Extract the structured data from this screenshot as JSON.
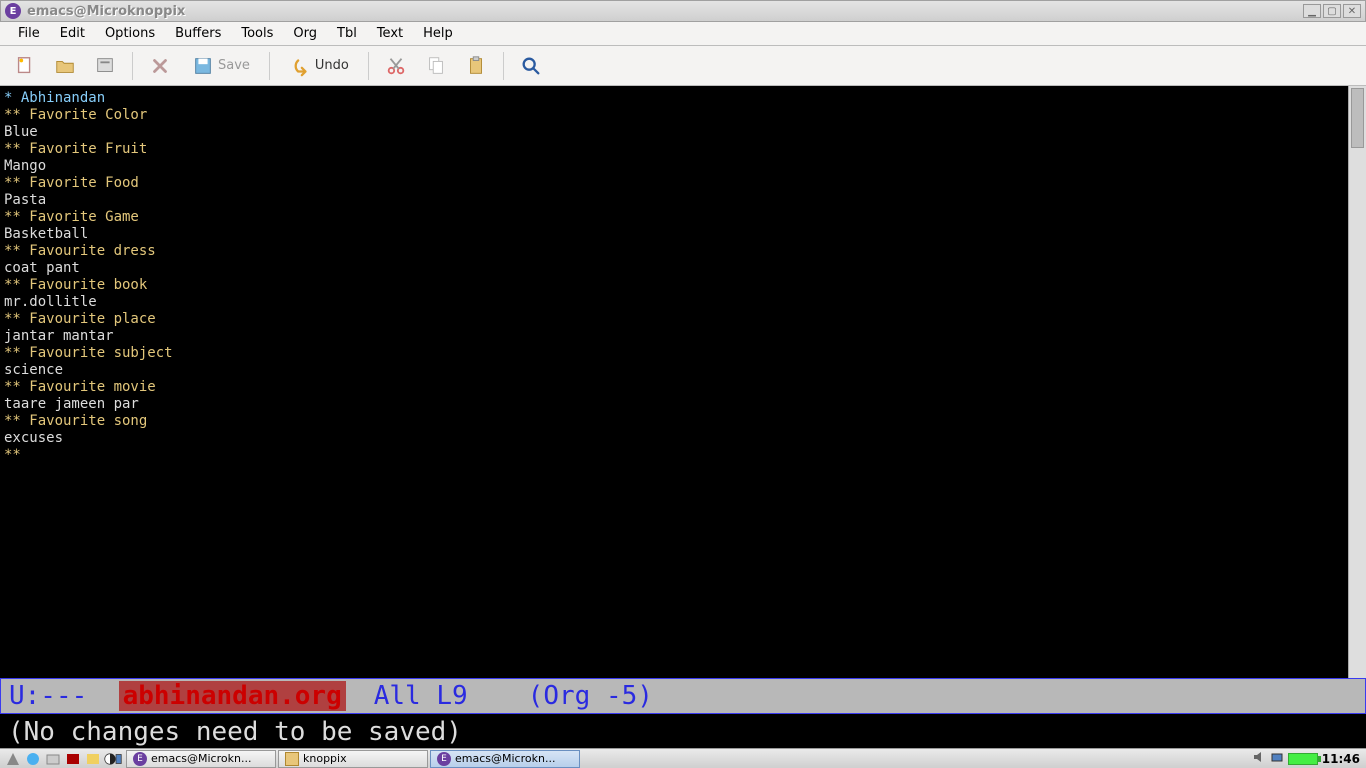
{
  "titlebar": {
    "title": "emacs@Microknoppix"
  },
  "menu": {
    "items": [
      "File",
      "Edit",
      "Options",
      "Buffers",
      "Tools",
      "Org",
      "Tbl",
      "Text",
      "Help"
    ]
  },
  "toolbar": {
    "save_label": "Save",
    "undo_label": "Undo"
  },
  "content": {
    "lines": [
      {
        "cls": "l1-head",
        "text": "* Abhinandan"
      },
      {
        "cls": "body-text",
        "text": " "
      },
      {
        "cls": "l2-head",
        "text": "** Favorite Color"
      },
      {
        "cls": "body-text",
        "text": "Blue"
      },
      {
        "cls": "l2-head",
        "text": "** Favorite Fruit"
      },
      {
        "cls": "body-text",
        "text": "Mango"
      },
      {
        "cls": "l2-head",
        "text": "** Favorite Food"
      },
      {
        "cls": "body-text",
        "text": "Pasta"
      },
      {
        "cls": "l2-head",
        "text": "** Favorite Game"
      },
      {
        "cls": "body-text",
        "text": "Basketball"
      },
      {
        "cls": "l2-head",
        "text": "** Favourite dress"
      },
      {
        "cls": "body-text",
        "text": "coat pant"
      },
      {
        "cls": "l2-head",
        "text": "** Favourite book"
      },
      {
        "cls": "body-text",
        "text": "mr.dollitle"
      },
      {
        "cls": "l2-head",
        "text": "** Favourite place"
      },
      {
        "cls": "body-text",
        "text": "jantar mantar"
      },
      {
        "cls": "l2-head",
        "text": "** Favourite subject"
      },
      {
        "cls": "body-text",
        "text": "science"
      },
      {
        "cls": "l2-head",
        "text": "** Favourite movie"
      },
      {
        "cls": "body-text",
        "text": "taare jameen par"
      },
      {
        "cls": "l2-head",
        "text": "** Favourite song"
      },
      {
        "cls": "body-text",
        "text": "excuses"
      },
      {
        "cls": "l2-head",
        "text": "**"
      }
    ]
  },
  "modeline": {
    "prefix": " U:--- ",
    "filename": "abhinandan.org",
    "position": "All L9",
    "mode": "(Org -5)"
  },
  "minibuffer": {
    "message": "(No changes need to be saved)"
  },
  "taskbar": {
    "tasks": [
      {
        "label": "emacs@Microkn...",
        "active": false
      },
      {
        "label": "knoppix",
        "active": false
      },
      {
        "label": "emacs@Microkn...",
        "active": true
      }
    ],
    "clock": "11:46"
  }
}
